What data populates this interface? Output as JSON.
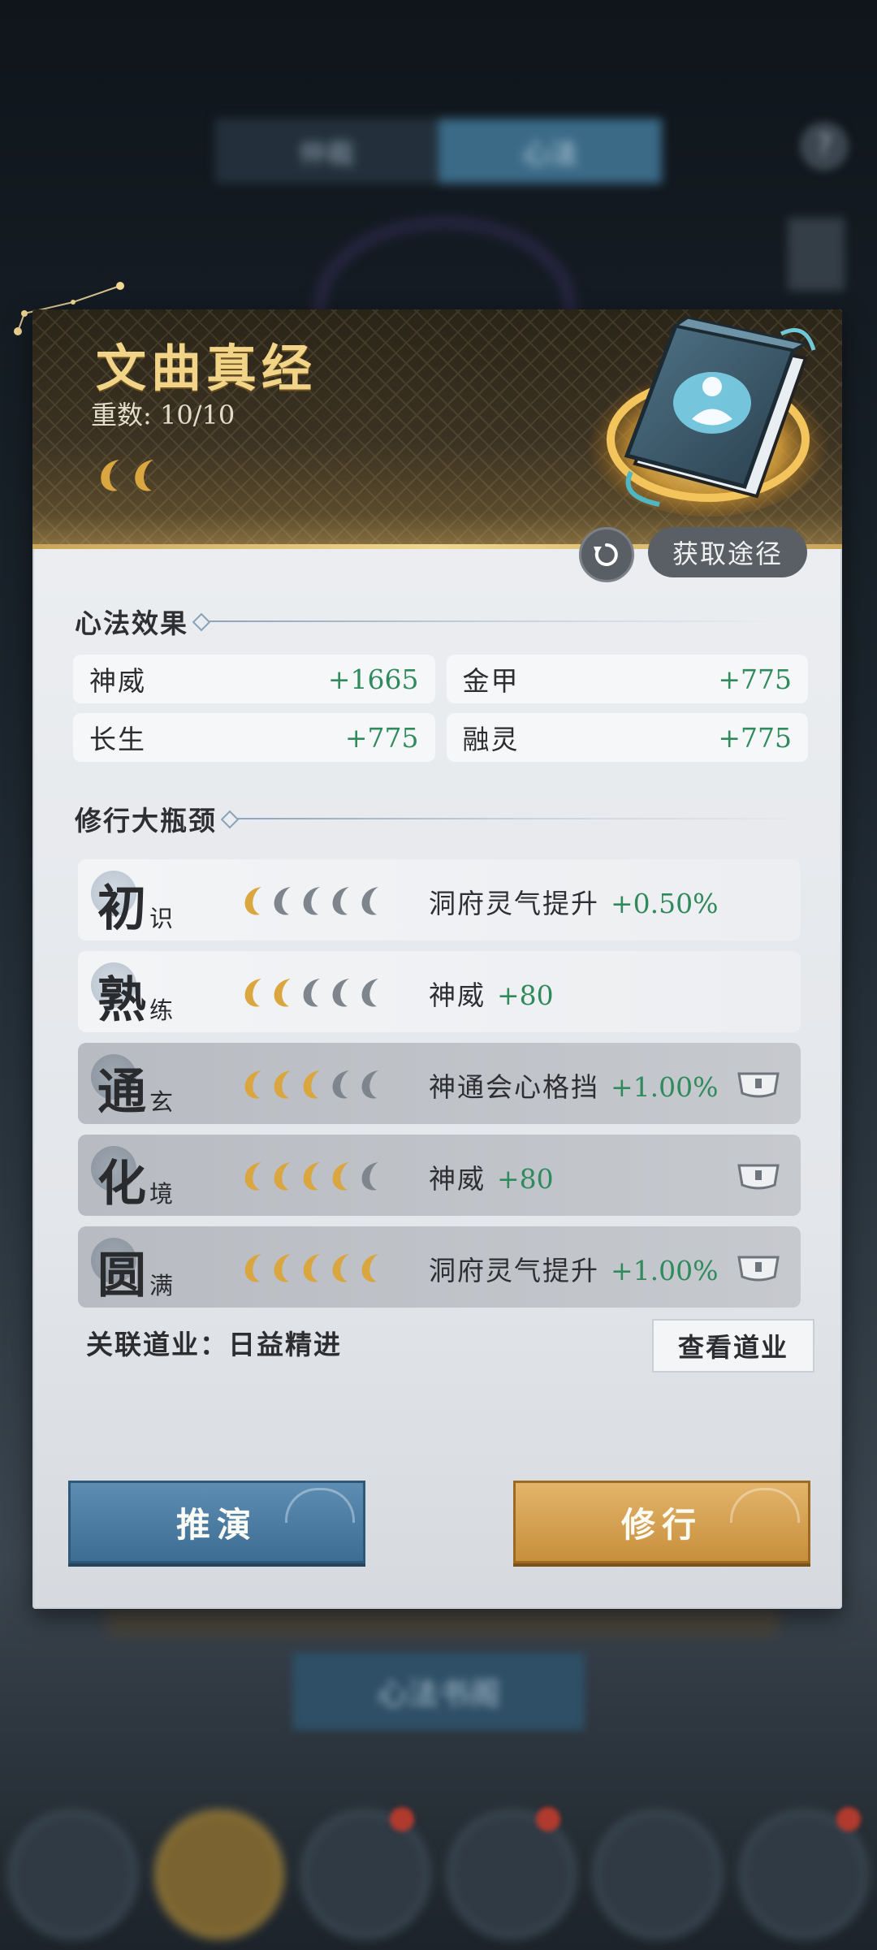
{
  "background": {
    "tabs": [
      "仲裁",
      "心法"
    ],
    "bottom_button": "心法书阁"
  },
  "header": {
    "title": "文曲真经",
    "level_label": "重数:",
    "level_value": "10/10",
    "source_button": "获取途径",
    "moon_count": 2
  },
  "effects": {
    "title": "心法效果",
    "stats": [
      {
        "name": "神威",
        "value": "+1665"
      },
      {
        "name": "金甲",
        "value": "+775"
      },
      {
        "name": "长生",
        "value": "+775"
      },
      {
        "name": "融灵",
        "value": "+775"
      }
    ]
  },
  "bottleneck": {
    "title": "修行大瓶颈",
    "stages": [
      {
        "big": "初",
        "small": "识",
        "filled": 1,
        "total": 5,
        "effect": "洞府灵气提升",
        "bonus": "+0.50%",
        "locked": false
      },
      {
        "big": "熟",
        "small": "练",
        "filled": 2,
        "total": 5,
        "effect": "神威",
        "bonus": "+80",
        "locked": false
      },
      {
        "big": "通",
        "small": "玄",
        "filled": 3,
        "total": 5,
        "effect": "神通会心格挡",
        "bonus": "+1.00%",
        "locked": true
      },
      {
        "big": "化",
        "small": "境",
        "filled": 4,
        "total": 5,
        "effect": "神威",
        "bonus": "+80",
        "locked": true
      },
      {
        "big": "圆",
        "small": "满",
        "filled": 5,
        "total": 5,
        "effect": "洞府灵气提升",
        "bonus": "+1.00%",
        "locked": true
      }
    ]
  },
  "linked": {
    "label": "关联道业：日益精进",
    "view_button": "查看道业"
  },
  "actions": {
    "deduce": "推演",
    "train": "修行"
  },
  "colors": {
    "gold": "#f2d488",
    "green": "#2f8a5c",
    "moon_filled": "#d9a640",
    "moon_empty": "#7e858c"
  }
}
